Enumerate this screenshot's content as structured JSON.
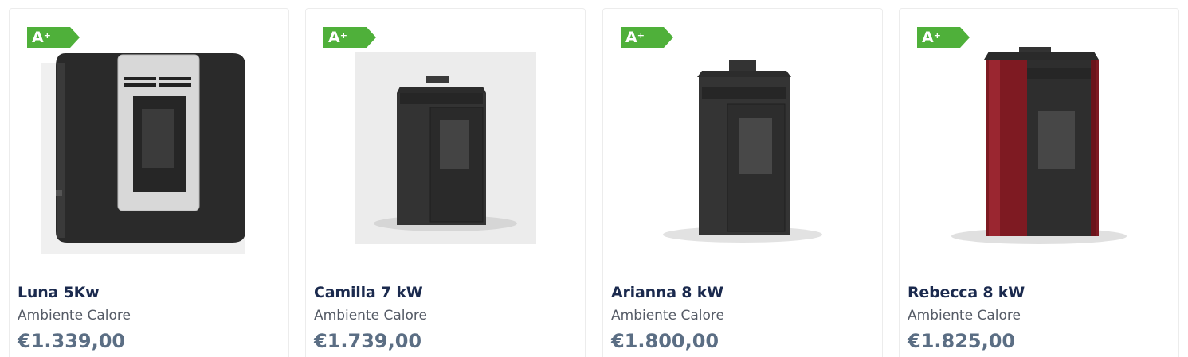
{
  "energy_label": {
    "grade": "A",
    "plus": "+",
    "color": "#4fb03a"
  },
  "products": [
    {
      "name": "Luna 5Kw",
      "brand": "Ambiente Calore",
      "price": "€1.339,00",
      "finish": "black-silver-wall"
    },
    {
      "name": "Camilla 7 kW",
      "brand": "Ambiente Calore",
      "price": "€1.739,00",
      "finish": "black"
    },
    {
      "name": "Arianna 8 kW",
      "brand": "Ambiente Calore",
      "price": "€1.800,00",
      "finish": "black"
    },
    {
      "name": "Rebecca 8 kW",
      "brand": "Ambiente Calore",
      "price": "€1.825,00",
      "finish": "bordeaux"
    }
  ]
}
